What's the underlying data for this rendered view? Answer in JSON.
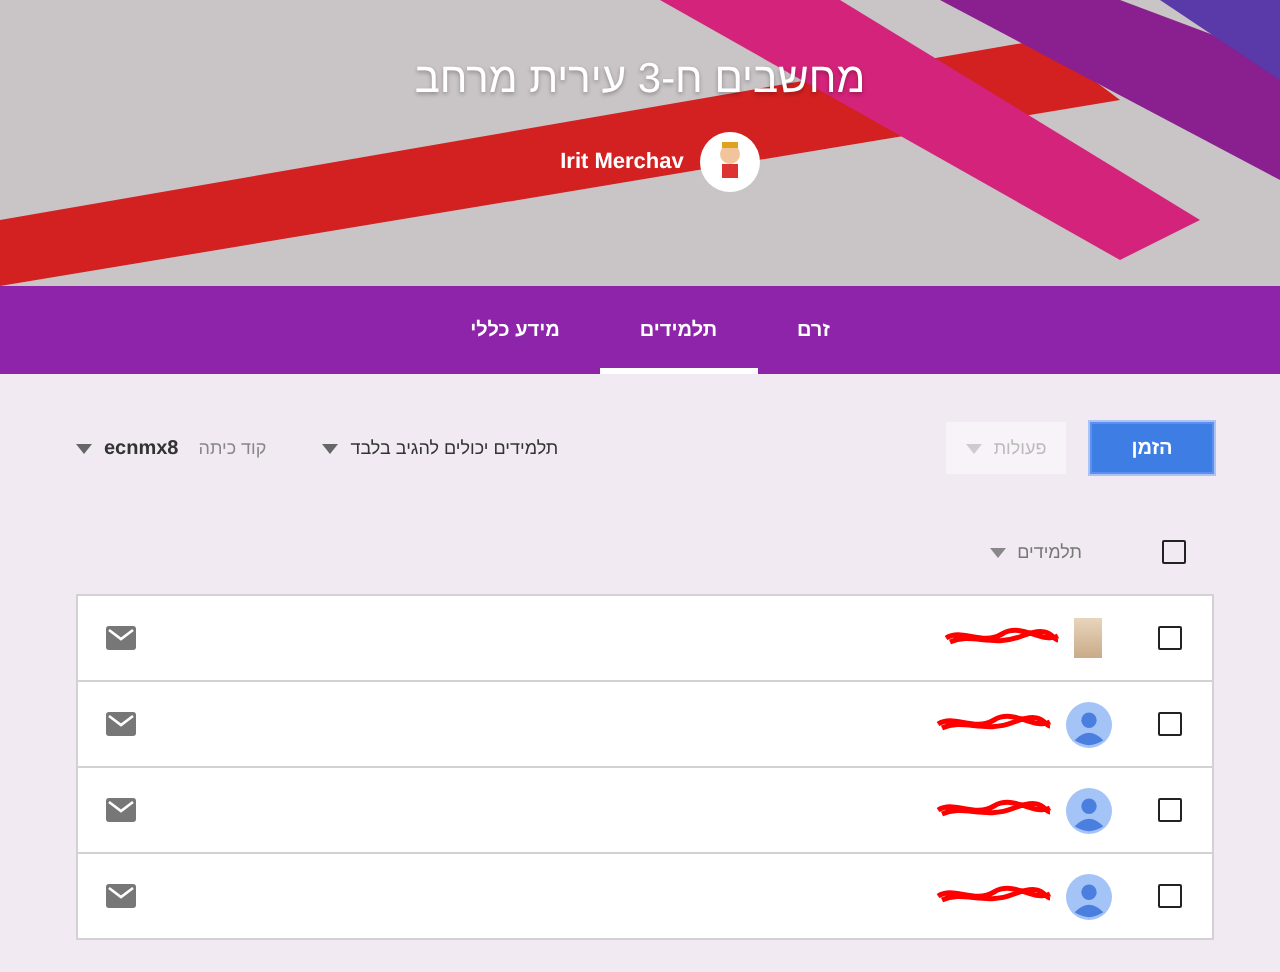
{
  "header": {
    "title": "מחשבים ח-3 עירית מרחב",
    "teacher": "Irit Merchav"
  },
  "tabs": [
    {
      "label": "זרם",
      "selected": false
    },
    {
      "label": "תלמידים",
      "selected": true
    },
    {
      "label": "מידע כללי",
      "selected": false
    }
  ],
  "toolbar": {
    "invite_button": "הזמן",
    "actions": {
      "label": "פעולות",
      "disabled": true
    },
    "permission": "תלמידים יכולים להגיב בלבד",
    "class_code_label": "קוד כיתה",
    "class_code": "ecnmx8"
  },
  "list_header": {
    "select_all_checked": false,
    "sort_label": "תלמידים"
  },
  "students": [
    {
      "kind": "photo",
      "checked": false
    },
    {
      "kind": "default",
      "checked": false
    },
    {
      "kind": "default",
      "checked": false
    },
    {
      "kind": "default",
      "checked": false
    }
  ]
}
